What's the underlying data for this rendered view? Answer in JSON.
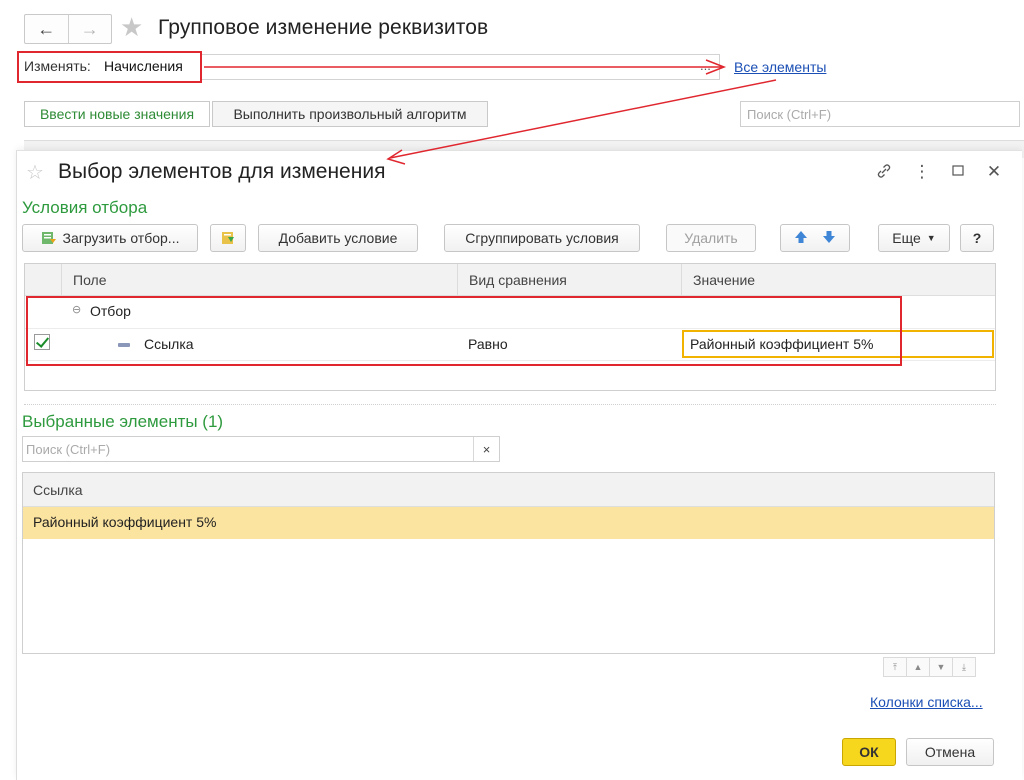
{
  "bg_window": {
    "title": "Групповое изменение реквизитов",
    "izm_label": "Изменять:",
    "izm_value": "Начисления",
    "izm_dots": "...",
    "all_elements_link": "Все элементы",
    "btn_new_values": "Ввести новые значения",
    "btn_algorithm": "Выполнить произвольный алгоритм",
    "search_placeholder": "Поиск (Ctrl+F)"
  },
  "dialog": {
    "title": "Выбор элементов для изменения",
    "conditions_title": "Условия отбора",
    "toolbar": {
      "load_filter": "Загрузить отбор...",
      "add_condition": "Добавить условие",
      "group_conditions": "Сгруппировать условия",
      "delete": "Удалить",
      "more": "Еще",
      "help": "?"
    },
    "filter_grid": {
      "columns": [
        "Поле",
        "Вид сравнения",
        "Значение"
      ],
      "group_row": "Отбор",
      "row": {
        "field": "Ссылка",
        "comparison": "Равно",
        "value": "Районный коэффициент 5%",
        "checked": true
      }
    },
    "selected_title": "Выбранные элементы (1)",
    "search_placeholder": "Поиск (Ctrl+F)",
    "search_clear": "×",
    "list_grid": {
      "column": "Ссылка",
      "rows": [
        "Районный коэффициент 5%"
      ]
    },
    "columns_link": "Колонки списка...",
    "ok": "ОК",
    "cancel": "Отмена"
  },
  "colors": {
    "green_title": "#2e9a3e",
    "annotation_red": "#e0272f",
    "selected_row": "#fbe3a0",
    "ok_button": "#f7d61e",
    "link": "#1b4fb5"
  }
}
